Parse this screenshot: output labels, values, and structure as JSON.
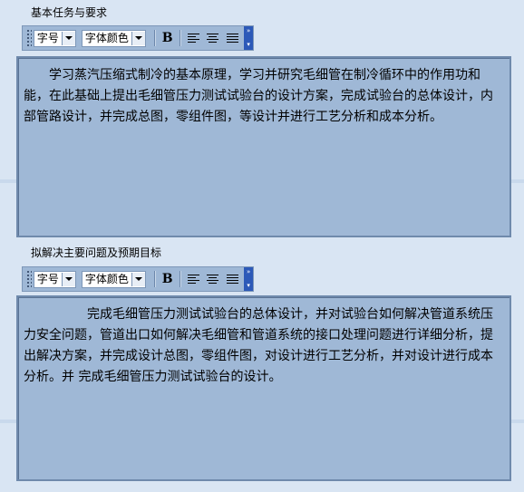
{
  "sections": [
    {
      "title": "基本任务与要求",
      "toolbar": {
        "font_size": "字号",
        "font_color": "字体颜色",
        "bold": "B"
      },
      "content": "学习蒸汽压缩式制冷的基本原理，学习并研究毛细管在制冷循环中的作用功和能，在此基础上提出毛细管压力测试试验台的设计方案，完成试验台的总体设计，内部管路设计，并完成总图，零组件图，等设计并进行工艺分析和成本分析。"
    },
    {
      "title": "拟解决主要问题及预期目标",
      "toolbar": {
        "font_size": "字号",
        "font_color": "字体颜色",
        "bold": "B"
      },
      "content": "完成毛细管压力测试试验台的总体设计，并对试验台如何解决管道系统压力安全问题，管道出口如何解决毛细管和管道系统的接口处理问题进行详细分析，提出解决方案，并完成设计总图，零组件图，对设计进行工艺分析，并对设计进行成本分析。并 完成毛细管压力测试试验台的设计。"
    }
  ],
  "icons": {
    "toolbar_grip": "grip-dots-icon",
    "bold": "bold-icon",
    "align_left": "align-left-icon",
    "align_center": "align-center-icon",
    "align_justify": "align-justify-icon",
    "toolbar_expand": "double-chevron-icon"
  },
  "colors": {
    "page_background": "#d9e5f3",
    "toolbar_background": "#9fb8d6",
    "editor_background": "#9fb8d6",
    "editor_border": "#6f8aac",
    "toolbar_end_accent": "#2c59b8"
  }
}
